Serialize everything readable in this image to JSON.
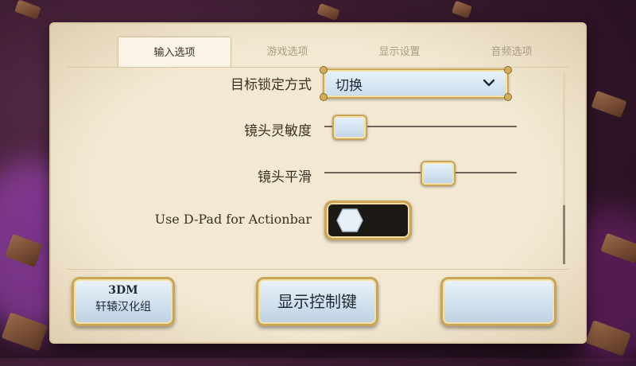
{
  "tabs": [
    {
      "label": "输入选项",
      "active": true
    },
    {
      "label": "游戏选项",
      "active": false
    },
    {
      "label": "显示设置",
      "active": false
    },
    {
      "label": "音频选项",
      "active": false
    }
  ],
  "settings": {
    "target_lock": {
      "label": "目标锁定方式",
      "value": "切换",
      "icon": "chevron-down-icon"
    },
    "camera_sensitivity": {
      "label": "镜头灵敏度",
      "value_fraction": 0.05
    },
    "camera_smoothing": {
      "label": "镜头平滑",
      "value_fraction": 0.6
    },
    "dpad_actionbar": {
      "label": "Use D-Pad for Actionbar",
      "on": false
    }
  },
  "buttons": {
    "left_line1": "3DM",
    "left_line2": "轩辕汉化组",
    "center": "显示控制键",
    "right": ""
  },
  "colors": {
    "parchment": "#f3e9d3",
    "gold_border": "#c9a558",
    "button_blue": "#c8dceb",
    "toggle_dark": "#1c1814"
  }
}
